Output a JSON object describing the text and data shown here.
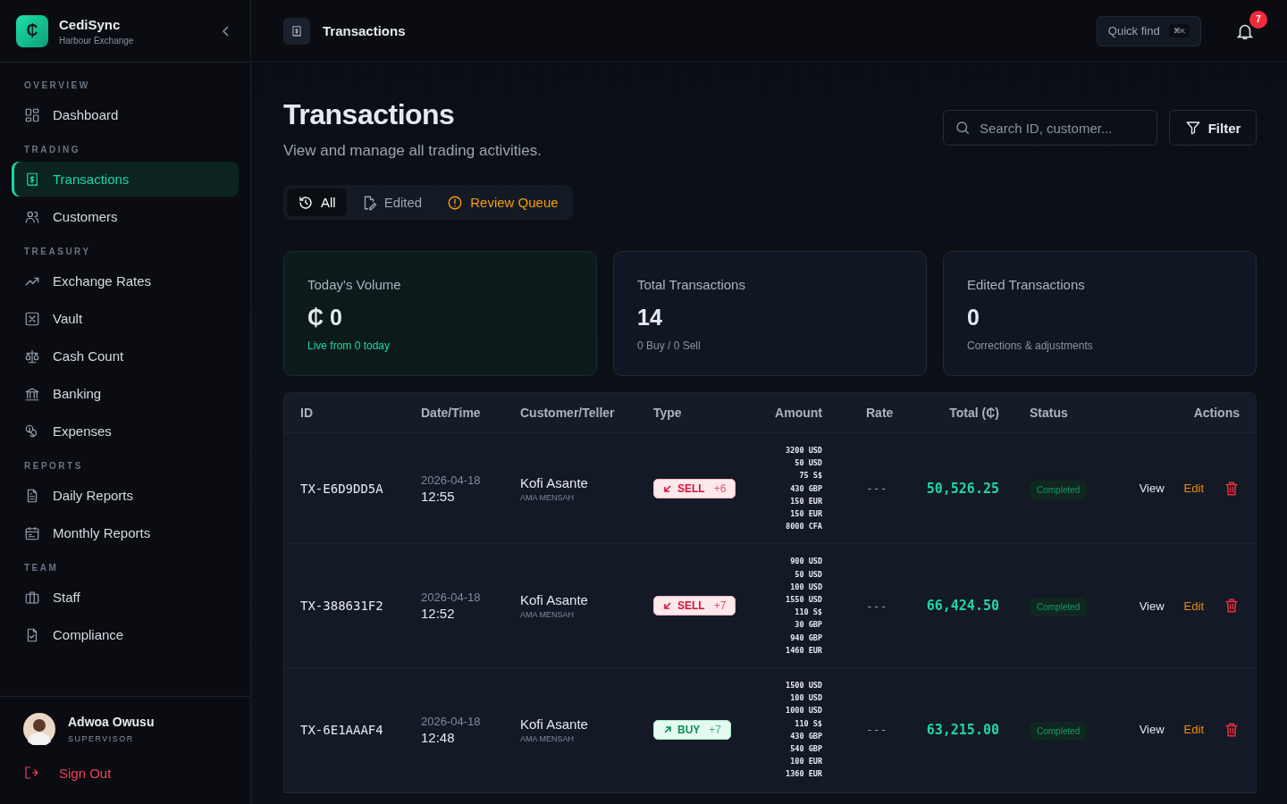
{
  "brand": {
    "name": "CediSync",
    "subtitle": "Harbour Exchange",
    "logo": "₵"
  },
  "sidebar": {
    "sections": [
      {
        "title": "OVERVIEW",
        "items": [
          {
            "label": "Dashboard",
            "selected": false
          }
        ]
      },
      {
        "title": "TRADING",
        "items": [
          {
            "label": "Transactions",
            "selected": true
          },
          {
            "label": "Customers",
            "selected": false
          }
        ]
      },
      {
        "title": "TREASURY",
        "items": [
          {
            "label": "Exchange Rates",
            "selected": false
          },
          {
            "label": "Vault",
            "selected": false
          },
          {
            "label": "Cash Count",
            "selected": false
          },
          {
            "label": "Banking",
            "selected": false
          },
          {
            "label": "Expenses",
            "selected": false
          }
        ]
      },
      {
        "title": "REPORTS",
        "items": [
          {
            "label": "Daily Reports",
            "selected": false
          },
          {
            "label": "Monthly Reports",
            "selected": false
          }
        ]
      },
      {
        "title": "TEAM",
        "items": [
          {
            "label": "Staff",
            "selected": false
          },
          {
            "label": "Compliance",
            "selected": false
          }
        ]
      }
    ],
    "user": {
      "name": "Adwoa Owusu",
      "role": "SUPERVISOR"
    },
    "sign_out": "Sign Out"
  },
  "header": {
    "title": "Transactions",
    "quick_find": "Quick find",
    "shortcut": "⌘K",
    "notifications": "7"
  },
  "page": {
    "title": "Transactions",
    "subtitle": "View and manage all trading activities.",
    "search": {
      "placeholder": "Search ID, customer..."
    },
    "filter": "Filter"
  },
  "tabs": [
    {
      "label": "All",
      "selected": true,
      "kind": "normal"
    },
    {
      "label": "Edited",
      "selected": false,
      "kind": "normal"
    },
    {
      "label": "Review Queue",
      "selected": false,
      "kind": "alert"
    }
  ],
  "cards": [
    {
      "label": "Today's Volume",
      "value": "₵ 0",
      "note": "Live from 0 today",
      "highlight": true
    },
    {
      "label": "Total Transactions",
      "value": "14",
      "note": "0 Buy / 0 Sell",
      "highlight": false
    },
    {
      "label": "Edited Transactions",
      "value": "0",
      "note": "Corrections & adjustments",
      "highlight": false
    }
  ],
  "table": {
    "columns": [
      "ID",
      "Date/Time",
      "Customer/Teller",
      "Type",
      "Amount",
      "Rate",
      "Total (₵)",
      "Status",
      "Actions"
    ],
    "rows": [
      {
        "id": "TX-E6D9DD5A",
        "date": "2026-04-18",
        "time": "12:55",
        "customer": "Kofi Asante",
        "teller": "AMA MENSAH",
        "type": {
          "kind": "sell",
          "label": "SELL",
          "count": "+6"
        },
        "amounts": [
          "3200 USD",
          "50 USD",
          "75 S$",
          "430 GBP",
          "150 EUR",
          "150 EUR",
          "8000 CFA"
        ],
        "rate": "---",
        "total": "50,526.25",
        "status": {
          "label": "Completed",
          "kind": "completed"
        },
        "actions": [
          "View",
          "Edit"
        ]
      },
      {
        "id": "TX-388631F2",
        "date": "2026-04-18",
        "time": "12:52",
        "customer": "Kofi Asante",
        "teller": "AMA MENSAH",
        "type": {
          "kind": "sell",
          "label": "SELL",
          "count": "+7"
        },
        "amounts": [
          "900 USD",
          "50 USD",
          "100 USD",
          "1550 USD",
          "110 S$",
          "30 GBP",
          "940 GBP",
          "1460 EUR"
        ],
        "rate": "---",
        "total": "66,424.50",
        "status": {
          "label": "Completed",
          "kind": "completed"
        },
        "actions": [
          "View",
          "Edit"
        ]
      },
      {
        "id": "TX-6E1AAAF4",
        "date": "2026-04-18",
        "time": "12:48",
        "customer": "Kofi Asante",
        "teller": "AMA MENSAH",
        "type": {
          "kind": "buy",
          "label": "BUY",
          "count": "+7"
        },
        "amounts": [
          "1500 USD",
          "100 USD",
          "1000 USD",
          "110 S$",
          "430 GBP",
          "540 GBP",
          "100 EUR",
          "1360 EUR"
        ],
        "rate": "---",
        "total": "63,215.00",
        "status": {
          "label": "Completed",
          "kind": "completed"
        },
        "actions": [
          "View",
          "Edit"
        ]
      }
    ]
  }
}
